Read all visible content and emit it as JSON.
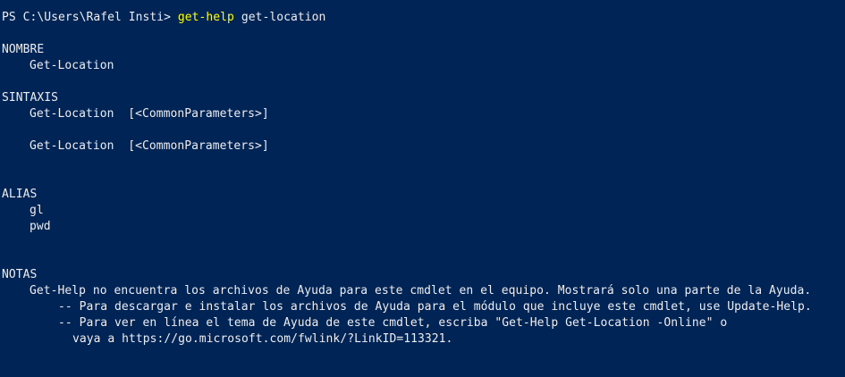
{
  "prompt": {
    "ps": "PS C:\\Users\\Rafel Insti> ",
    "command": "get-help",
    "args": " get-location"
  },
  "nombre": {
    "heading": "NOMBRE",
    "value": "Get-Location"
  },
  "sintaxis": {
    "heading": "SINTAXIS",
    "lines": [
      "Get-Location  [<CommonParameters>]",
      "Get-Location  [<CommonParameters>]"
    ]
  },
  "alias": {
    "heading": "ALIAS",
    "items": [
      "gl",
      "pwd"
    ]
  },
  "notas": {
    "heading": "NOTAS",
    "line1": "Get-Help no encuentra los archivos de Ayuda para este cmdlet en el equipo. Mostrará solo una parte de la Ayuda.",
    "line2": "-- Para descargar e instalar los archivos de Ayuda para el módulo que incluye este cmdlet, use Update-Help.",
    "line3": "-- Para ver en línea el tema de Ayuda de este cmdlet, escriba \"Get-Help Get-Location -Online\" o",
    "line4": "vaya a https://go.microsoft.com/fwlink/?LinkID=113321."
  },
  "colors": {
    "background": "#012456",
    "foreground": "#eeedf0",
    "command": "#ffff00"
  }
}
